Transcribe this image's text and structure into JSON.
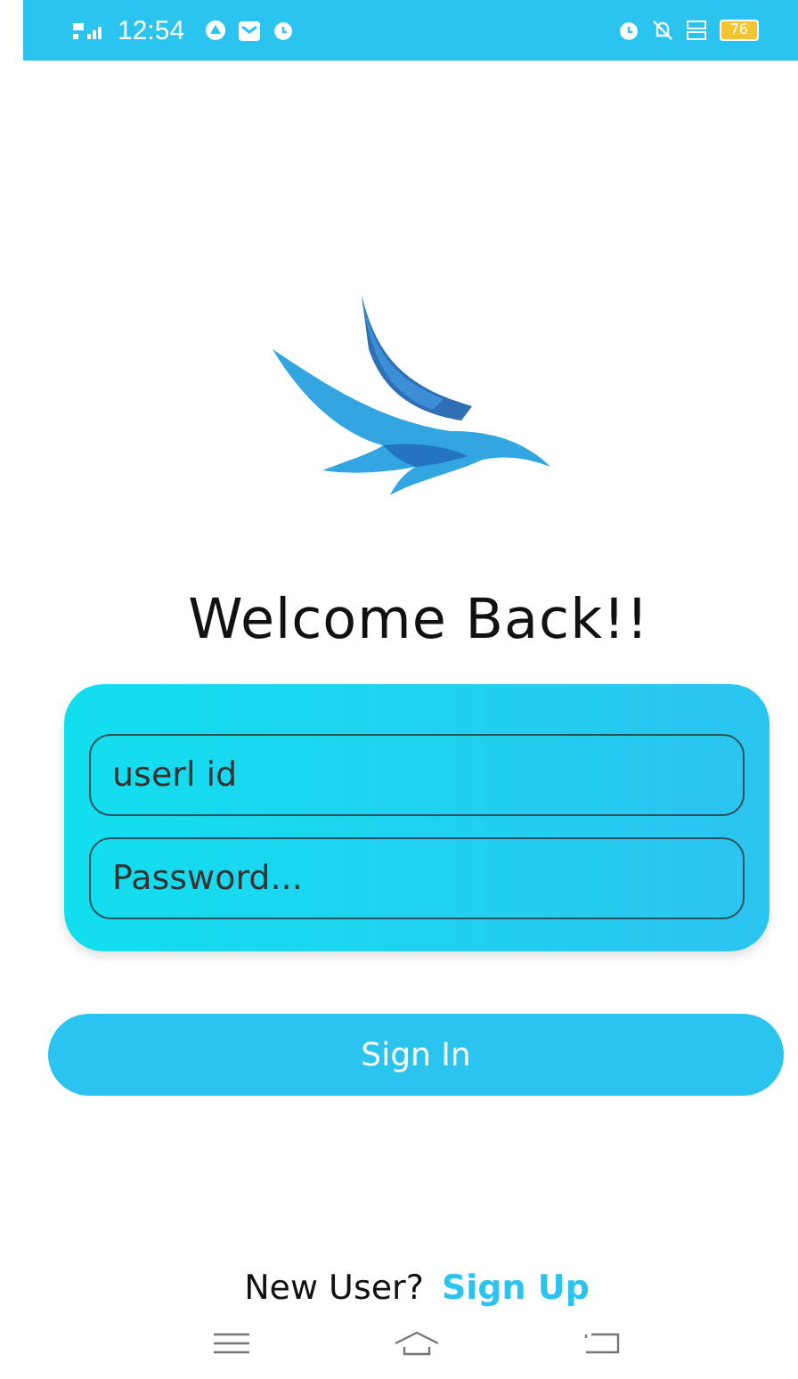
{
  "status_bar": {
    "time": "12:54",
    "battery": "76"
  },
  "title": "Welcome Back!!",
  "form": {
    "fields": [
      {
        "placeholder": "userl id"
      },
      {
        "placeholder": "Password..."
      }
    ],
    "submit": "Sign In"
  },
  "footer": {
    "prompt": "New User?",
    "link": "Sign Up"
  }
}
